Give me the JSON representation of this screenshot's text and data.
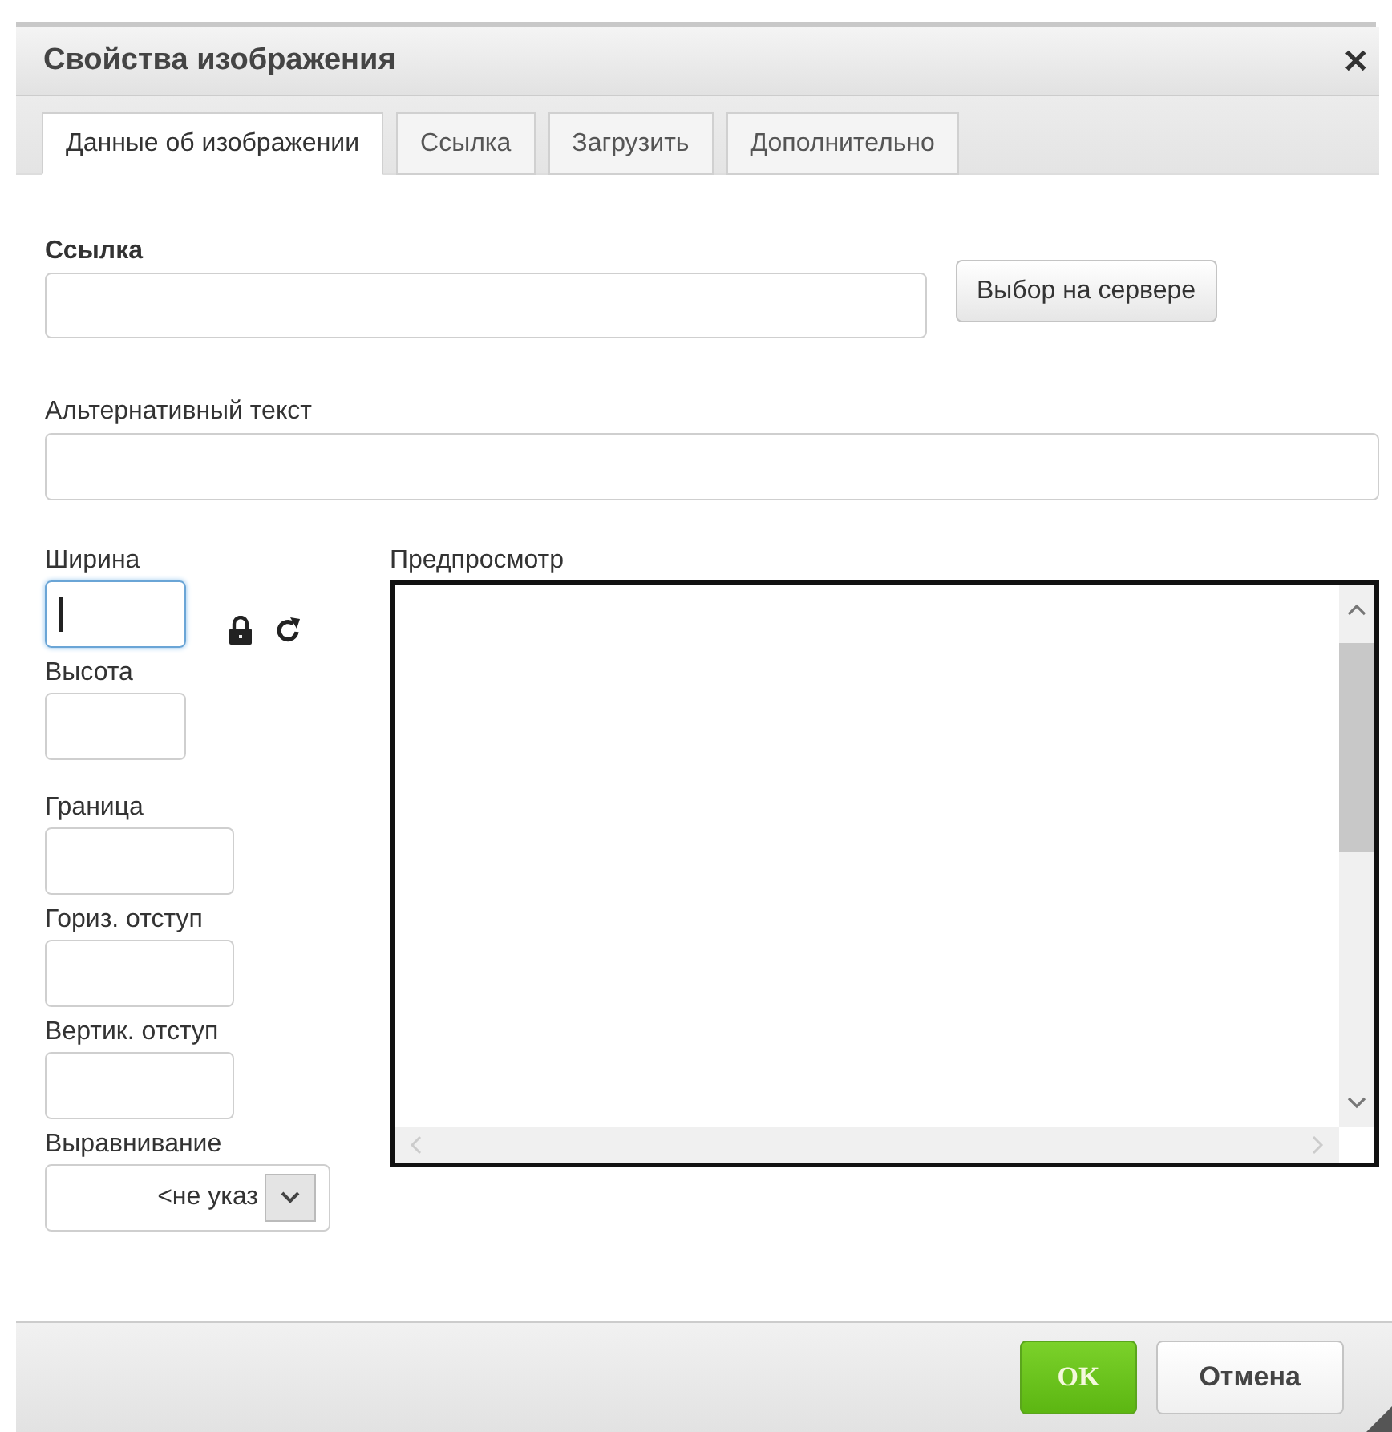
{
  "dialog": {
    "title": "Свойства изображения",
    "close": "✕"
  },
  "tabs": [
    {
      "label": "Данные об изображении",
      "selected": true
    },
    {
      "label": "Ссылка",
      "selected": false
    },
    {
      "label": "Загрузить",
      "selected": false
    },
    {
      "label": "Дополнительно",
      "selected": false
    }
  ],
  "url": {
    "label": "Ссылка",
    "browse_button": "Выбор на сервере"
  },
  "alt": {
    "label": "Альтернативный текст"
  },
  "size_fields": [
    {
      "label": "Ширина",
      "focused": true
    },
    {
      "label": "Высота",
      "focused": false
    }
  ],
  "spacing_fields": [
    {
      "label": "Граница",
      "focused": false
    },
    {
      "label": "Гориз. отступ",
      "focused": false
    },
    {
      "label": "Вертик. отступ",
      "focused": false
    }
  ],
  "align": {
    "label": "Выравнивание",
    "value": "<не указ"
  },
  "preview": {
    "label": "Предпросмотр"
  },
  "buttons": [
    {
      "label": "OK",
      "kind": "primary"
    },
    {
      "label": "Отмена",
      "kind": "secondary"
    }
  ]
}
